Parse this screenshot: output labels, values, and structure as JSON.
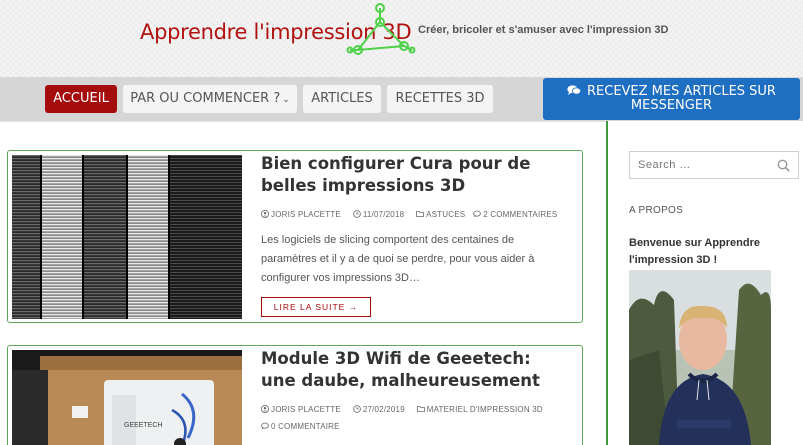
{
  "header": {
    "logo_text": "Apprendre l'impression 3D",
    "tagline": "Créer, bricoler et s'amuser avec l'impression 3D"
  },
  "nav": {
    "items": [
      {
        "label": "ACCUEIL",
        "active": true
      },
      {
        "label": "PAR OU COMMENCER ?",
        "active": false,
        "has_dropdown": true
      },
      {
        "label": "ARTICLES",
        "active": false
      },
      {
        "label": "RECETTES 3D",
        "active": false
      }
    ],
    "messenger_line1": "RECEVEZ MES ARTICLES SUR",
    "messenger_line2": "MESSENGER"
  },
  "posts": [
    {
      "title": "Bien configurer Cura pour de belles impressions 3D",
      "author": "JORIS PLACETTE",
      "date": "11/07/2018",
      "category": "ASTUCES",
      "comments": "2 COMMENTAIRES",
      "excerpt": "Les logiciels de slicing comportent des centaines de paramètres et il y a de quoi se perdre, pour vous aider à configurer vos impressions 3D…",
      "read_more": "LIRE LA SUITE →"
    },
    {
      "title": "Module 3D Wifi de Geeetech: une daube, malheureusement",
      "author": "JORIS PLACETTE",
      "date": "27/02/2019",
      "category": "MATERIEL D'IMPRESSION 3D",
      "comments": "0 COMMENTAIRE",
      "thumb_box_label": "GEEETECH"
    }
  ],
  "sidebar": {
    "search_placeholder": "Search …",
    "about_title": "A PROPOS",
    "welcome": "Benvenue sur Apprendre l'impression 3D !"
  },
  "colors": {
    "brand_red": "#a50d0d",
    "messenger_blue": "#1e6ec2",
    "card_border_green": "#5aa85a",
    "logo_green": "#4fd14a"
  }
}
